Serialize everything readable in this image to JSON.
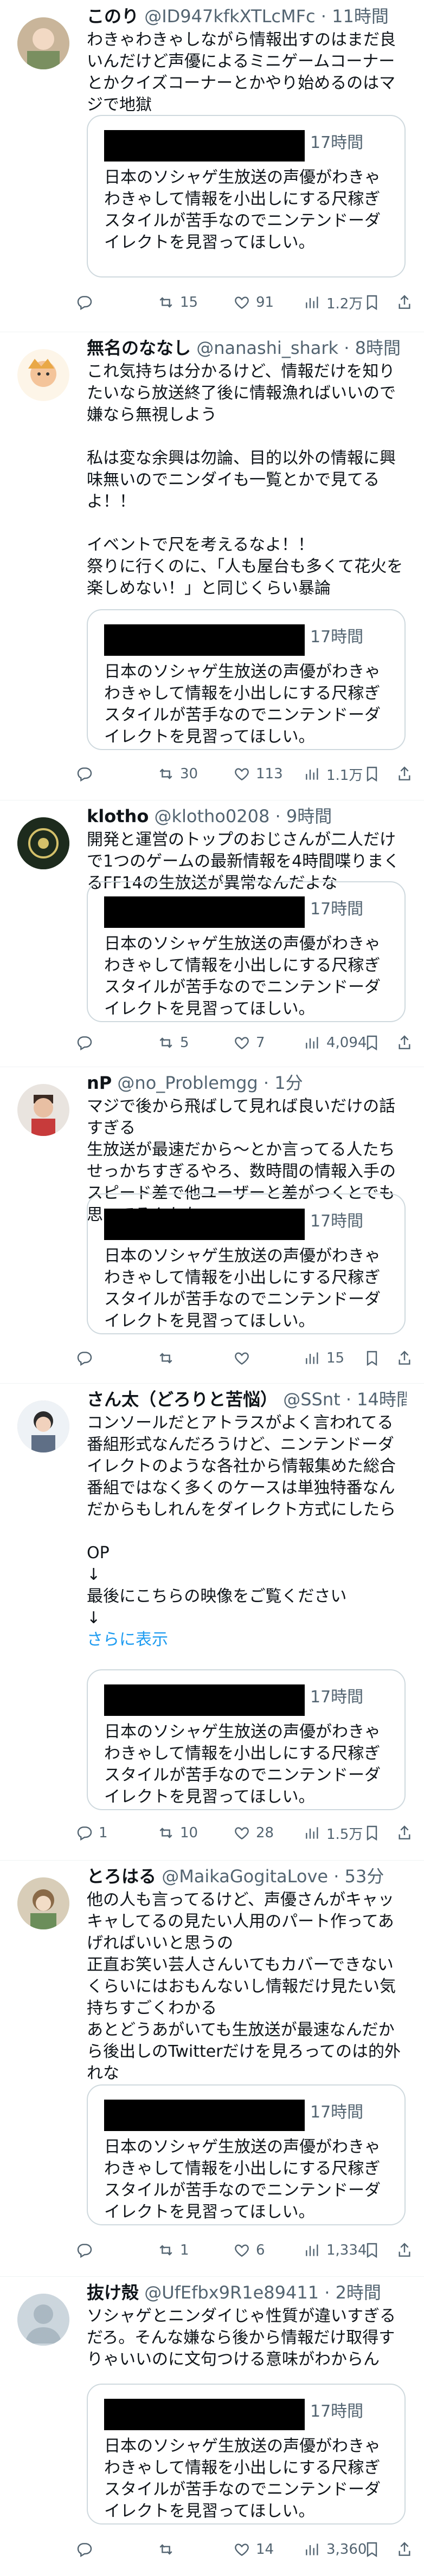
{
  "quote": {
    "time": "17時間",
    "text": "日本のソシャゲ生放送の声優がわきゃわきゃして情報を小出しにする尺稼ぎスタイルが苦手なのでニンテンドーダイレクトを見習ってほしい。"
  },
  "posts": [
    {
      "name": "このり",
      "handle": "@ID947kfkXTLcMFc",
      "time": "11時間",
      "text": "わきゃわきゃしながら情報出すのはまだ良いんだけど声優によるミニゲームコーナーとかクイズコーナーとかやり始めるのはマジで地獄",
      "replies": "",
      "reposts": "15",
      "likes": "91",
      "views": "1.2万"
    },
    {
      "name": "無名のななし",
      "handle": "@nanashi_shark",
      "time": "8時間",
      "text": "これ気持ちは分かるけど、情報だけを知りたいなら放送終了後に情報漁ればいいので嫌なら無視しよう\n\n私は変な余興は勿論、目的以外の情報に興味無いのでニンダイも一覧とかで見てるよ！！\n\nイベントで尺を考えるなよ！！\n祭りに行くのに、「人も屋台も多くて花火を楽しめない！」と同じくらい暴論",
      "replies": "",
      "reposts": "30",
      "likes": "113",
      "views": "1.1万"
    },
    {
      "name": "klotho",
      "handle": "@klotho0208",
      "time": "9時間",
      "text": "開発と運営のトップのおじさんが二人だけで1つのゲームの最新情報を4時間喋りまくるFF14の生放送が異常なんだよな",
      "replies": "",
      "reposts": "5",
      "likes": "7",
      "views": "4,094"
    },
    {
      "name": "nP",
      "handle": "@no_Problemgg",
      "time": "1分",
      "text": "マジで後から飛ばして見れば良いだけの話すぎる\n生放送が最速だから〜とか言ってる人たちせっかちすぎるやろ、数時間の情報入手のスピード差で他ユーザーと差がつくとでも思ってるんかな",
      "replies": "",
      "reposts": "",
      "likes": "",
      "views": "15"
    },
    {
      "name": "さん太（どろりと苦悩）",
      "handle": "@SSnt",
      "time": "14時間",
      "text": "コンソールだとアトラスがよく言われてる番組形式なんだろうけど、ニンテンドーダイレクトのような各社から情報集めた総合番組ではなく多くのケースは単独特番なんだからもしれんをダイレクト方式にしたら\n\nOP\n↓\n最後にこちらの映像をご覧ください\n↓",
      "more": "さらに表示",
      "replies": "1",
      "reposts": "10",
      "likes": "28",
      "views": "1.5万"
    },
    {
      "name": "とろはる",
      "handle": "@MaikaGogitaLove",
      "time": "53分",
      "text": "他の人も言ってるけど、声優さんがキャッキャしてるの見たい人用のパート作ってあげればいいと思うの\n正直お笑い芸人さんいてもカバーできないくらいにはおもんないし情報だけ見たい気持ちすごくわかる\nあとどうあがいても生放送が最速なんだから後出しのTwitterだけを見ろってのは的外れな",
      "replies": "",
      "reposts": "1",
      "likes": "6",
      "views": "1,334"
    },
    {
      "name": "抜け殻",
      "handle": "@UfEfbx9R1e89411",
      "time": "2時間",
      "text": "ソシャゲとニンダイじゃ性質が違いすぎるだろ。そんな嫌なら後から情報だけ取得すりゃいいのに文句つける意味がわからん",
      "replies": "",
      "reposts": "",
      "likes": "14",
      "views": "3,360"
    }
  ]
}
